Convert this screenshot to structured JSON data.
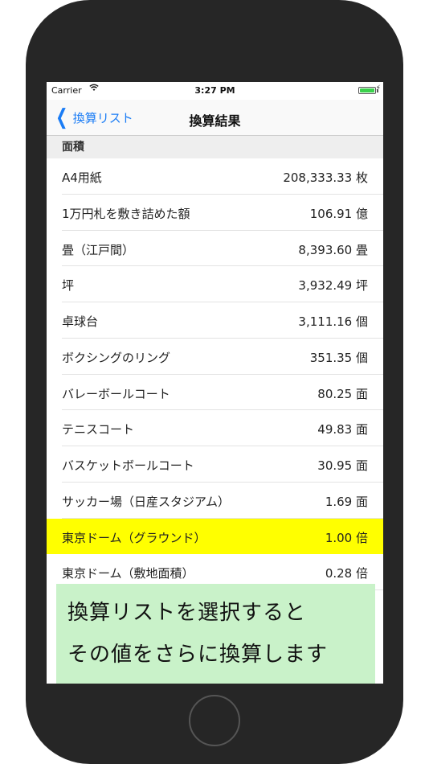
{
  "status_bar": {
    "carrier": "Carrier",
    "time": "3:27 PM"
  },
  "nav": {
    "back_label": "換算リスト",
    "title": "換算結果"
  },
  "section": {
    "title": "面積"
  },
  "rows": [
    {
      "label": "A4用紙",
      "value": "208,333.33 枚"
    },
    {
      "label": "1万円札を敷き詰めた額",
      "value": "106.91 億"
    },
    {
      "label": "畳（江戸間）",
      "value": "8,393.60 畳"
    },
    {
      "label": "坪",
      "value": "3,932.49 坪"
    },
    {
      "label": "卓球台",
      "value": "3,111.16 個"
    },
    {
      "label": "ボクシングのリング",
      "value": "351.35 個"
    },
    {
      "label": "バレーボールコート",
      "value": "80.25 面"
    },
    {
      "label": "テニスコート",
      "value": "49.83 面"
    },
    {
      "label": "バスケットボールコート",
      "value": "30.95 面"
    },
    {
      "label": "サッカー場（日産スタジアム）",
      "value": "1.69 面"
    },
    {
      "label": "東京ドーム（グラウンド）",
      "value": "1.00 倍"
    },
    {
      "label": "東京ドーム（敷地面積）",
      "value": "0.28 倍"
    }
  ],
  "caption": {
    "line1": "換算リストを選択すると",
    "line2": "その値をさらに換算します"
  },
  "colors": {
    "highlight": "#ffff00",
    "caption_bg": "#c9f2c9",
    "accent": "#1a7cf5"
  }
}
